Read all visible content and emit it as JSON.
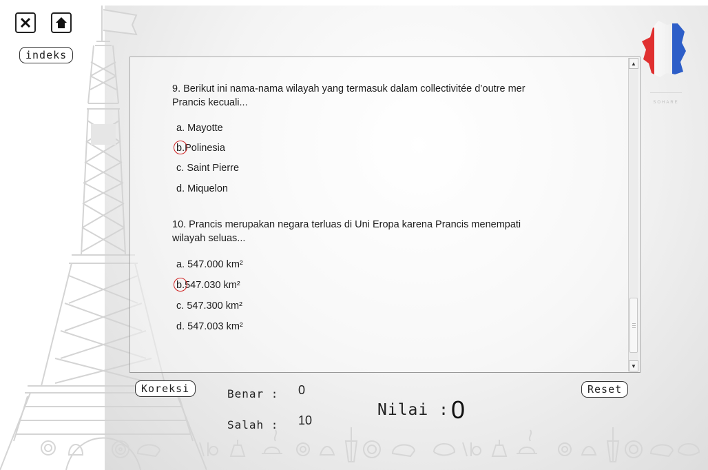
{
  "toolbar": {
    "close_icon": "x-icon",
    "home_icon": "home-icon",
    "close_glyph": "X",
    "indeks_label": "indeks"
  },
  "brand": {
    "text": "SOHARE"
  },
  "quiz": {
    "questions": [
      {
        "text": "9. Berikut ini nama-nama wilayah yang termasuk dalam collectivitée d’outre mer Prancis kecuali...",
        "options": [
          {
            "letter": "a.",
            "text": "Mayotte",
            "selected": false
          },
          {
            "letter": "b.",
            "text": "Polinesia",
            "selected": true
          },
          {
            "letter": "c.",
            "text": "Saint Pierre",
            "selected": false
          },
          {
            "letter": "d.",
            "text": "Miquelon",
            "selected": false
          }
        ]
      },
      {
        "text": "10. Prancis merupakan negara terluas di Uni Eropa karena Prancis menempati wilayah seluas...",
        "options": [
          {
            "letter": "a.",
            "text": "547.000 km²",
            "selected": false
          },
          {
            "letter": "b.",
            "text": "547.030 km²",
            "selected": true
          },
          {
            "letter": "c.",
            "text": "547.300 km²",
            "selected": false
          },
          {
            "letter": "d.",
            "text": "547.003 km²",
            "selected": false
          }
        ]
      }
    ]
  },
  "score": {
    "koreksi_label": "Koreksi",
    "reset_label": "Reset",
    "benar_label": "Benar :",
    "benar_value": "0",
    "salah_label": "Salah :",
    "salah_value": "10",
    "nilai_label": "Nilai :",
    "nilai_value": "0"
  },
  "colors": {
    "selection_circle": "#d02424",
    "flag_red": "#e03030",
    "flag_blue": "#2d5ec8"
  }
}
